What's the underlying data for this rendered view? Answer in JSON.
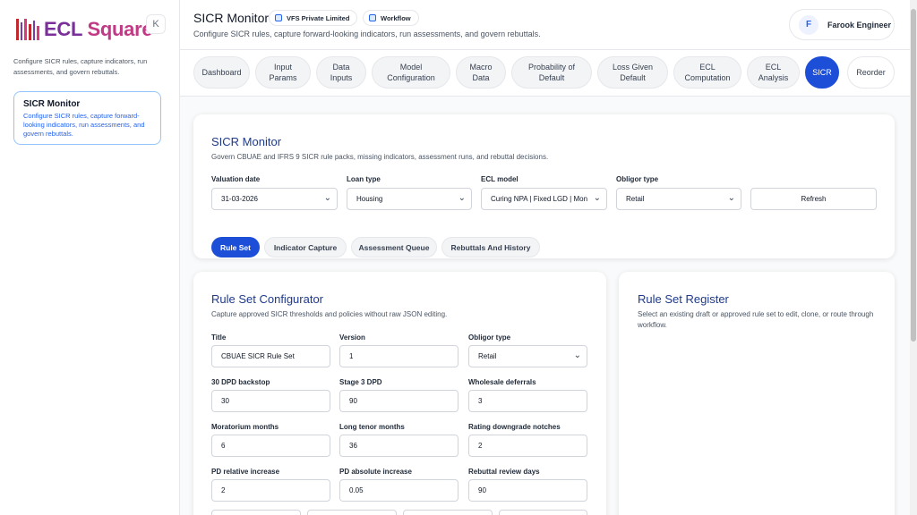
{
  "sidebar": {
    "brand": {
      "ecl": "ECL",
      "square": "Square"
    },
    "collapse_label": "K",
    "description": "Configure SICR rules, capture indicators, run assessments, and govern rebuttals.",
    "active_item": {
      "title": "SICR Monitor",
      "description": "Configure SICR rules, capture forward-looking indicators, run assessments, and govern rebuttals."
    }
  },
  "header": {
    "title": "SICR Monitor",
    "chips": [
      "VFS Private Limited",
      "Workflow"
    ],
    "subtitle": "Configure SICR rules, capture forward-looking indicators, run assessments, and govern rebuttals.",
    "user": {
      "initial": "F",
      "name": "Farook Engineer"
    }
  },
  "tabs": [
    {
      "label": "Dashboard"
    },
    {
      "label": "Input\nParams"
    },
    {
      "label": "Data\nInputs"
    },
    {
      "label": "Model\nConfiguration"
    },
    {
      "label": "Macro\nData"
    },
    {
      "label": "Probability of\nDefault"
    },
    {
      "label": "Loss Given\nDefault"
    },
    {
      "label": "ECL\nComputation"
    },
    {
      "label": "ECL\nAnalysis"
    },
    {
      "label": "SICR",
      "active": true
    },
    {
      "label": "Reorder"
    }
  ],
  "monitor_card": {
    "title": "SICR Monitor",
    "subtitle": "Govern CBUAE and IFRS 9 SICR rule packs, missing indicators, assessment runs, and rebuttal decisions.",
    "filters": {
      "valuation_date": {
        "label": "Valuation date",
        "value": "31-03-2026"
      },
      "loan_type": {
        "label": "Loan type",
        "value": "Housing"
      },
      "ecl_model": {
        "label": "ECL model",
        "value": "Curing NPA | Fixed LGD | Mon"
      },
      "obligor_type": {
        "label": "Obligor type",
        "value": "Retail"
      },
      "refresh_label": "Refresh"
    },
    "subtabs": [
      {
        "label": "Rule Set",
        "active": true
      },
      {
        "label": "Indicator Capture"
      },
      {
        "label": "Assessment Queue"
      },
      {
        "label": "Rebuttals And History"
      }
    ]
  },
  "configurator": {
    "title": "Rule Set Configurator",
    "subtitle": "Capture approved SICR thresholds and policies without raw JSON editing.",
    "fields": {
      "title": {
        "label": "Title",
        "value": "CBUAE SICR Rule Set"
      },
      "version": {
        "label": "Version",
        "value": "1"
      },
      "obligor_type": {
        "label": "Obligor type",
        "value": "Retail"
      },
      "dpd_backstop": {
        "label": "30 DPD backstop",
        "value": "30"
      },
      "stage3_dpd": {
        "label": "Stage 3 DPD",
        "value": "90"
      },
      "wholesale_deferrals": {
        "label": "Wholesale deferrals",
        "value": "3"
      },
      "moratorium_months": {
        "label": "Moratorium months",
        "value": "6"
      },
      "long_tenor_months": {
        "label": "Long tenor months",
        "value": "36"
      },
      "rating_downgrade": {
        "label": "Rating downgrade notches",
        "value": "2"
      },
      "pd_relative": {
        "label": "PD relative increase",
        "value": "2"
      },
      "pd_absolute": {
        "label": "PD absolute increase",
        "value": "0.05"
      },
      "rebuttal_days": {
        "label": "Rebuttal review days",
        "value": "90"
      }
    }
  },
  "register": {
    "title": "Rule Set Register",
    "subtitle": "Select an existing draft or approved rule set to edit, clone, or route through workflow."
  }
}
